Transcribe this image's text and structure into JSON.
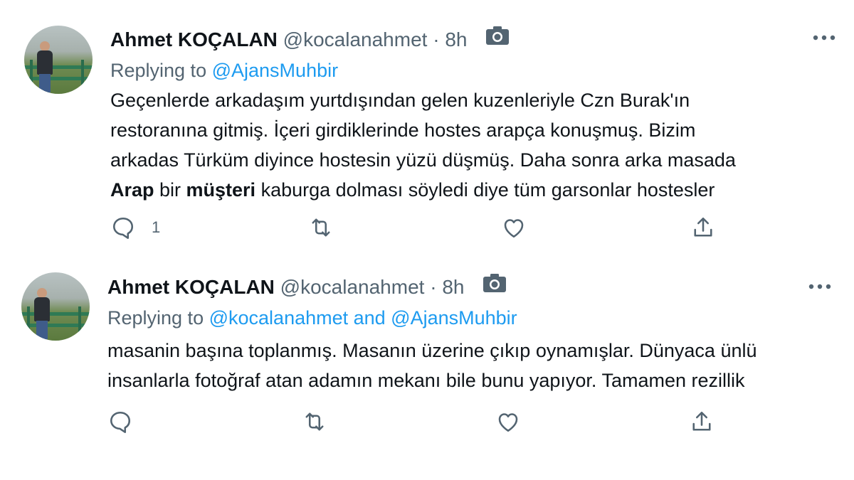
{
  "colors": {
    "text_primary": "#0f1419",
    "text_secondary": "#536471",
    "link": "#1d9bf0"
  },
  "tweets": [
    {
      "author_name": "Ahmet KOÇALAN",
      "handle": "@kocalanahmet",
      "separator": "·",
      "time": "8h",
      "media_icon": "camera-icon",
      "replying_prefix": "Replying to",
      "replying_to": "@AjansMuhbir",
      "lines": [
        {
          "parts": [
            {
              "text": "Geçenlerde arkadaşım yurtdışından gelen kuzenleriyle Czn Burak'ın"
            }
          ]
        },
        {
          "parts": [
            {
              "text": "restoranına gitmiş. İçeri girdiklerinde hostes arapça konuşmuş. Bizim"
            }
          ]
        },
        {
          "parts": [
            {
              "text": "arkadas Türküm diyince hostesin yüzü düşmüş. Daha sonra arka masada"
            }
          ]
        },
        {
          "parts": [
            {
              "text": "Arap",
              "bold": true
            },
            {
              "text": " bir "
            },
            {
              "text": "müşteri",
              "bold": true
            },
            {
              "text": " kaburga dolması söyledi diye tüm garsonlar hostesler"
            }
          ]
        }
      ],
      "actions": {
        "reply_count": "1",
        "retweet_count": "",
        "like_count": ""
      }
    },
    {
      "author_name": "Ahmet KOÇALAN",
      "handle": "@kocalanahmet",
      "separator": "·",
      "time": "8h",
      "media_icon": "camera-icon",
      "replying_prefix": "Replying to",
      "replying_to": "@kocalanahmet and @AjansMuhbir",
      "lines": [
        {
          "parts": [
            {
              "text": "masanin başına toplanmış. Masanın üzerine çıkıp oynamışlar. Dünyaca ünlü"
            }
          ]
        },
        {
          "parts": [
            {
              "text": "insanlarla fotoğraf atan adamın mekanı bile bunu yapıyor. Tamamen rezillik"
            }
          ]
        }
      ],
      "actions": {
        "reply_count": "",
        "retweet_count": "",
        "like_count": ""
      }
    }
  ]
}
